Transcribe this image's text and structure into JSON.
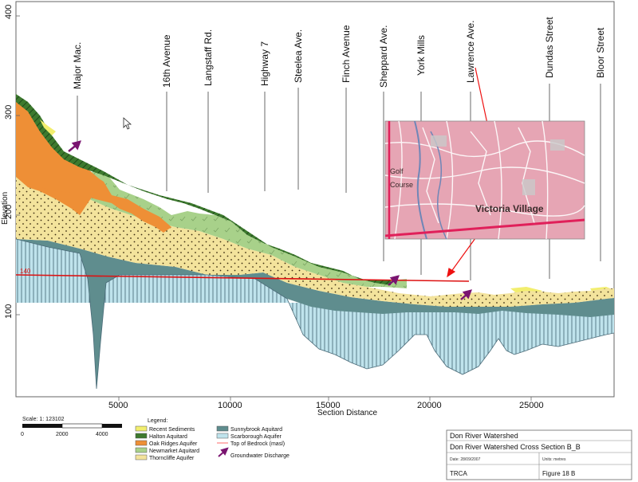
{
  "axes": {
    "y_label": "Elevation",
    "x_label": "Section Distance",
    "y_ticks": [
      "400",
      "300",
      "200",
      "100"
    ],
    "x_ticks": [
      "5000",
      "10000",
      "15000",
      "20000",
      "25000"
    ]
  },
  "streets": [
    "Major Mac.",
    "16th Avenue",
    "Langstaff Rd.",
    "Highway 7",
    "Steelea Ave.",
    "Finch Avenue",
    "Sheppard Ave.",
    "York Mills",
    "Lawrence Ave.",
    "Dundas Street",
    "Bloor Street"
  ],
  "marker": {
    "label": "140"
  },
  "inset_map": {
    "labels": {
      "golf": "Golf",
      "course": "Course",
      "village": "Victoria Village"
    }
  },
  "scale": {
    "label": "Scale: 1: 123102",
    "ticks": [
      "0",
      "2000",
      "4000"
    ]
  },
  "legend": {
    "title": "Legend:",
    "items": [
      {
        "label": "Recent Sediments",
        "color": "#f2ee6e"
      },
      {
        "label": "Halton Aquitard",
        "color": "#3d7a2e"
      },
      {
        "label": "Oak Ridges Aquifer",
        "color": "#ee8f36"
      },
      {
        "label": "Newmarket Aquitard",
        "color": "#a8d18a"
      },
      {
        "label": "Thorncliffe Aquifer",
        "color": "#f3e39c"
      },
      {
        "label": "Sunnybrook Aquitard",
        "color": "#5f8d8e"
      },
      {
        "label": "Scarborough Aquifer",
        "color": "#bfe3ec"
      },
      {
        "label": "Top of Bedrock (masl)",
        "color": "#ff9a9a"
      },
      {
        "label": "Groundwater Discharge",
        "color": "#7a1470"
      }
    ]
  },
  "title_block": {
    "org": "Don River Watershed",
    "title": "Don River Watershed Cross Section B_B",
    "date": "Date: 28/09/2007",
    "units": "Units: metres",
    "agency": "TRCA",
    "figure": "Figure 18 B"
  }
}
